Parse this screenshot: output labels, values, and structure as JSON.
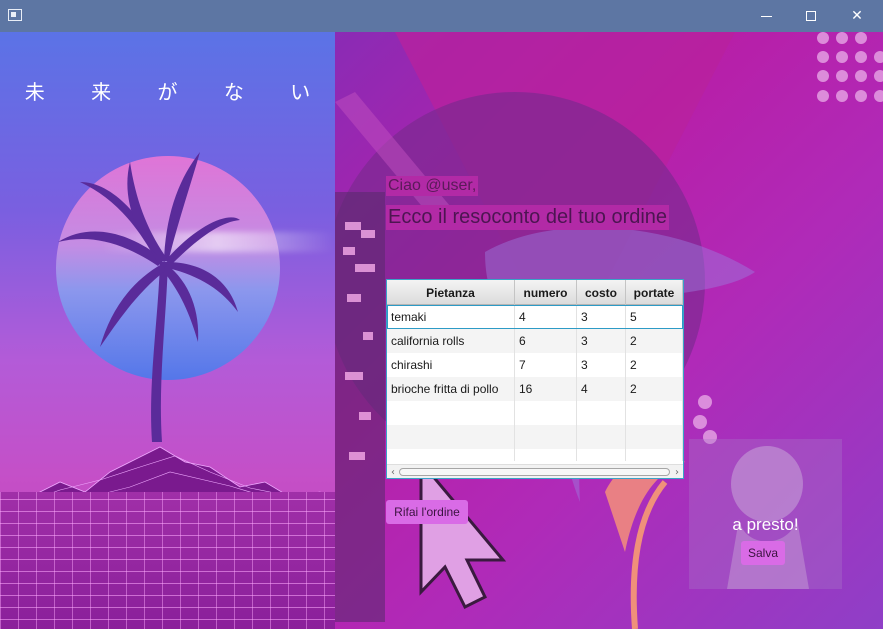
{
  "window": {
    "minimize_glyph": "minimize",
    "maximize_glyph": "maximize",
    "close_glyph": "✕"
  },
  "left_panel": {
    "title": "未 来 が な い"
  },
  "main": {
    "greeting": "Ciao @user,",
    "summary": "Ecco il resoconto del tuo ordine",
    "table": {
      "columns": [
        "Pietanza",
        "numero",
        "costo",
        "portate"
      ],
      "rows": [
        [
          "temaki",
          "4",
          "3",
          "5"
        ],
        [
          "california rolls",
          "6",
          "3",
          "2"
        ],
        [
          "chirashi",
          "7",
          "3",
          "2"
        ],
        [
          "brioche fritta di pollo",
          "16",
          "4",
          "2"
        ]
      ],
      "empty_rows": 3
    },
    "redo_button": "Rifai l'ordine",
    "farewell": "a presto!",
    "save_button": "Salva"
  },
  "colors": {
    "titlebar": "#5d76a3",
    "accent_button": "#d96be6",
    "table_border": "#39a3c8"
  }
}
